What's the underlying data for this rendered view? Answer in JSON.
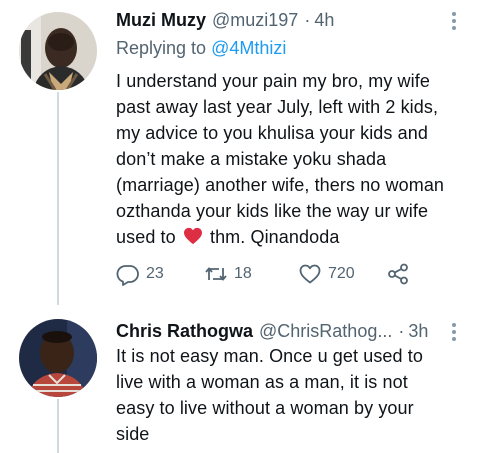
{
  "tweets": [
    {
      "name": "Muzi Muzy",
      "handle": "@muzi197",
      "separator": "·",
      "time": "4h",
      "replying_to_label": "Replying to",
      "replying_to_handle": "@4Mthizi",
      "body_lines": [
        "I understand your pain my bro, my wife",
        "past away last year July, left with 2 kids,",
        "my advice to you khulisa your kids and",
        "don’t make a mistake yoku shada",
        "(marriage) another wife, thers no woman",
        "ozthanda your kids like the way ur wife"
      ],
      "last_line_before_emoji": "used to",
      "emoji": "red-heart",
      "last_line_after_emoji": "thm. Qinandoda",
      "replies": "23",
      "retweets": "18",
      "likes": "720"
    },
    {
      "name": "Chris Rathogwa",
      "handle": "@ChrisRathog...",
      "separator": "·",
      "time": "3h",
      "body_lines": [
        "It is not easy man. Once u get used to",
        "live with a woman as a man, it is not",
        "easy to live without a woman by your",
        "side"
      ]
    }
  ],
  "colors": {
    "accent": "#1d9bf0",
    "secondary_text": "#536471",
    "heart": "#e0245e"
  },
  "icons": [
    "more-icon",
    "reply-icon",
    "retweet-icon",
    "like-icon",
    "share-icon"
  ]
}
